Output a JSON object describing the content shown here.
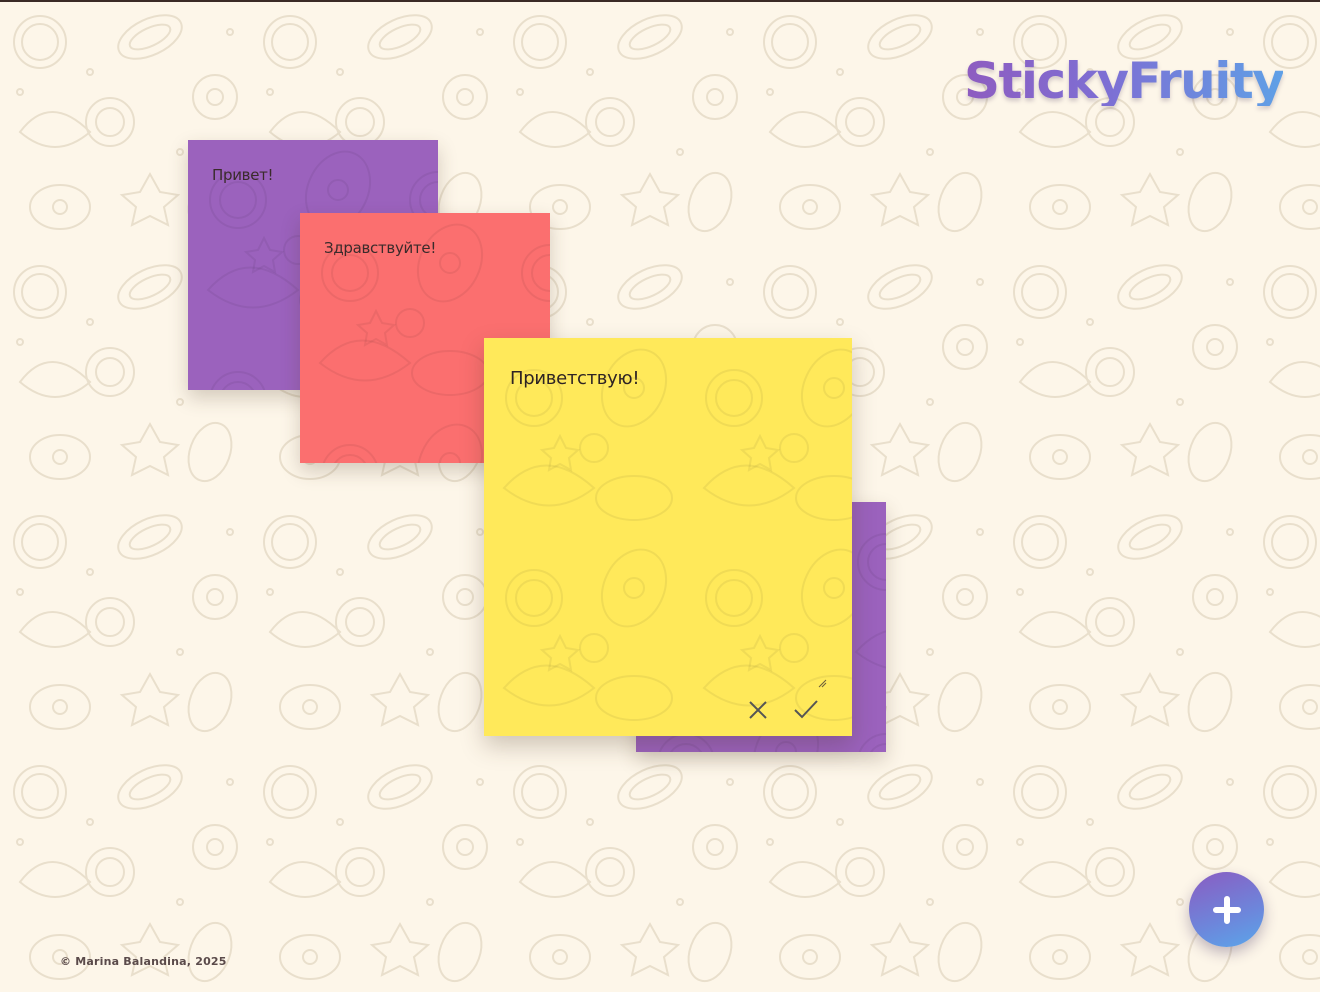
{
  "app": {
    "logo_text": "StickyFruity",
    "logo_gradient": [
      "#8e5cc0",
      "#5fa0e6"
    ],
    "background_color": "#fdf6e9"
  },
  "notes": [
    {
      "id": "purple-1",
      "text": "Привет!",
      "color": "#9b62bd"
    },
    {
      "id": "red",
      "text": "Здравствуйте!",
      "color": "#fb6f6f"
    },
    {
      "id": "yellow",
      "text": "Приветствую!",
      "color": "#ffe95a",
      "editing": true
    },
    {
      "id": "purple-2",
      "text": "",
      "color": "#9b62bd"
    }
  ],
  "editor": {
    "cancel_icon": "close-icon",
    "confirm_icon": "check-icon"
  },
  "fab": {
    "icon": "plus-icon",
    "gradient": [
      "#8a5cc2",
      "#5aa6ea"
    ]
  },
  "footer": {
    "copyright": "© Marina Balandina, 2025"
  }
}
